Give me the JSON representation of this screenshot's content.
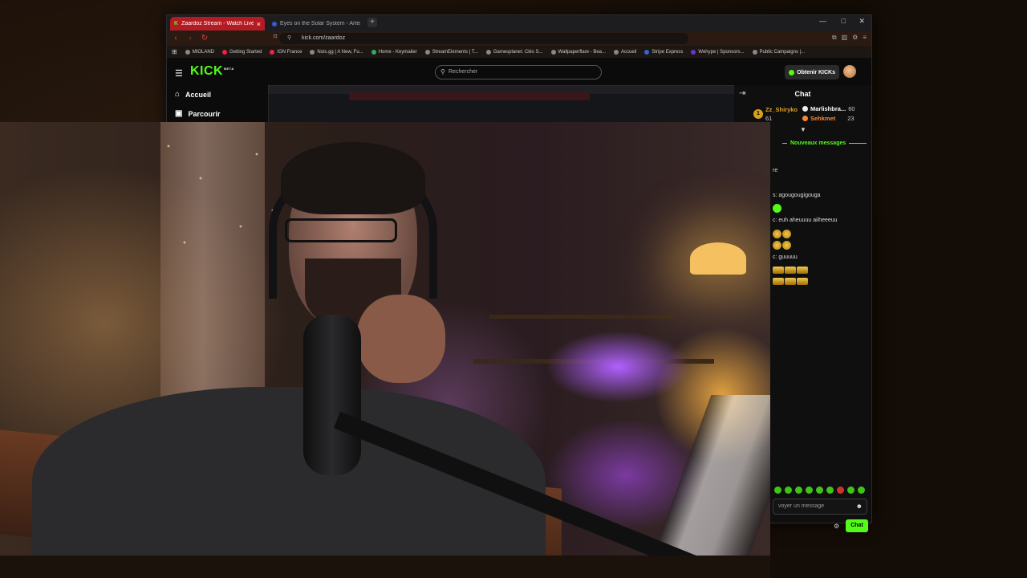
{
  "tabs": [
    {
      "title": "Zaardoz Stream - Watch Live on",
      "active": true
    },
    {
      "title": "Eyes on the Solar System - Artemis I",
      "active": false
    }
  ],
  "address": {
    "url": "kick.com/zaardoz"
  },
  "bookmarks": [
    "MIOLAND",
    "Getting Started",
    "IGN France",
    "Nois.gg | A New, Fu...",
    "Home - Keymailer",
    "StreamElements | T...",
    "Gamesplanet: Clés S...",
    "Wallpaperflare - Bea...",
    "Accueil",
    "Stripe Express",
    "Wehype | Sponsors...",
    "Public Campaigns |..."
  ],
  "header": {
    "logo": "KICK",
    "logo_sup": "BETA",
    "search_placeholder": "Rechercher",
    "obtain_label": "Obtenir KICKs"
  },
  "sidenav": {
    "home": "Accueil",
    "browse": "Parcourir"
  },
  "chat": {
    "title": "Chat",
    "leaders": [
      {
        "rank": "1",
        "name": "Zz_Shiryko",
        "count": "61",
        "color": "#e0a020"
      },
      {
        "name": "Marlishbra...",
        "count": "60",
        "color": "#ffffff"
      },
      {
        "name": "Sehkmet",
        "count": "23",
        "color": "#f08a3a"
      }
    ],
    "new_messages": "Nouveaux messages",
    "messages": [
      {
        "text": "re"
      },
      {
        "text": "s: agougougigouga"
      },
      {
        "text": "c: euh aheuuuu aiiheeeuu"
      },
      {
        "text": "c: guuuuu"
      }
    ],
    "input_placeholder": "voyer un message",
    "send_label": "Chat"
  },
  "colors": {
    "accent": "#53fc18",
    "tab_active": "#b51b22"
  }
}
